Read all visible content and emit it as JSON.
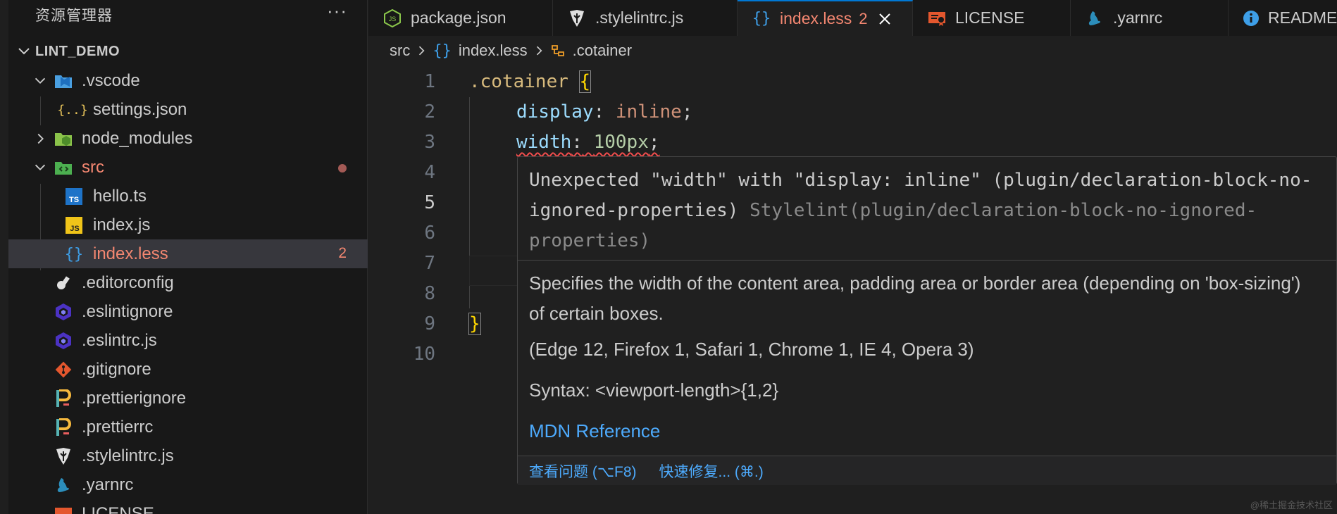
{
  "sidebar": {
    "title": "资源管理器",
    "more_label": "···",
    "project": "LINT_DEMO",
    "items": [
      {
        "label": ".vscode",
        "icon": "vscode-folder-icon"
      },
      {
        "label": "settings.json",
        "icon": "json-icon"
      },
      {
        "label": "node_modules",
        "icon": "node-folder-icon"
      },
      {
        "label": "src",
        "icon": "src-folder-icon"
      },
      {
        "label": "hello.ts",
        "icon": "typescript-icon"
      },
      {
        "label": "index.js",
        "icon": "javascript-icon"
      },
      {
        "label": "index.less",
        "icon": "braces-icon",
        "badge": "2"
      },
      {
        "label": ".editorconfig",
        "icon": "editorconfig-icon"
      },
      {
        "label": ".eslintignore",
        "icon": "eslint-icon"
      },
      {
        "label": ".eslintrc.js",
        "icon": "eslint-icon"
      },
      {
        "label": ".gitignore",
        "icon": "git-icon"
      },
      {
        "label": ".prettierignore",
        "icon": "prettier-icon"
      },
      {
        "label": ".prettierrc",
        "icon": "prettier-icon"
      },
      {
        "label": ".stylelintrc.js",
        "icon": "stylelint-icon"
      },
      {
        "label": ".yarnrc",
        "icon": "yarn-icon"
      },
      {
        "label": "LICENSE",
        "icon": "license-icon"
      }
    ]
  },
  "tabs": [
    {
      "label": "package.json",
      "icon": "nodejs-icon"
    },
    {
      "label": ".stylelintrc.js",
      "icon": "stylelint-icon"
    },
    {
      "label": "index.less",
      "icon": "braces-icon",
      "count": "2",
      "active": true
    },
    {
      "label": "LICENSE",
      "icon": "license-icon"
    },
    {
      "label": ".yarnrc",
      "icon": "yarn-icon"
    },
    {
      "label": "README",
      "icon": "info-icon"
    }
  ],
  "breadcrumb": [
    "src",
    "index.less",
    ".cotainer"
  ],
  "editor": {
    "line_numbers": [
      "1",
      "2",
      "3",
      "4",
      "5",
      "6",
      "7",
      "8",
      "9",
      "10"
    ],
    "current_line": "5",
    "line1_selector": ".cotainer",
    "line1_brace": "{",
    "line2_prop": "display",
    "line2_value": "inline",
    "line3_prop": "width",
    "line3_value": "100px",
    "colon": ":",
    "semicolon": ";",
    "line9_brace": "}"
  },
  "hover": {
    "message": "Unexpected \"width\" with \"display: inline\" (plugin/declaration-block-no-ignored-properties)",
    "source": "Stylelint(plugin/declaration-block-no-ignored-properties)",
    "description": "Specifies the width of the content area, padding area or border area (depending on 'box-sizing') of certain boxes.",
    "compat": "(Edge 12, Firefox 1, Safari 1, Chrome 1, IE 4, Opera 3)",
    "syntax": "Syntax: <viewport-length>{1,2}",
    "mdn_link": "MDN Reference",
    "action_view_problem": "查看问题 (⌥F8)",
    "action_quick_fix": "快速修复... (⌘.)"
  },
  "colors": {
    "accent": "#0078d4",
    "error": "#f48771",
    "link": "#4daafc"
  },
  "watermark": "@稀土掘金技术社区"
}
